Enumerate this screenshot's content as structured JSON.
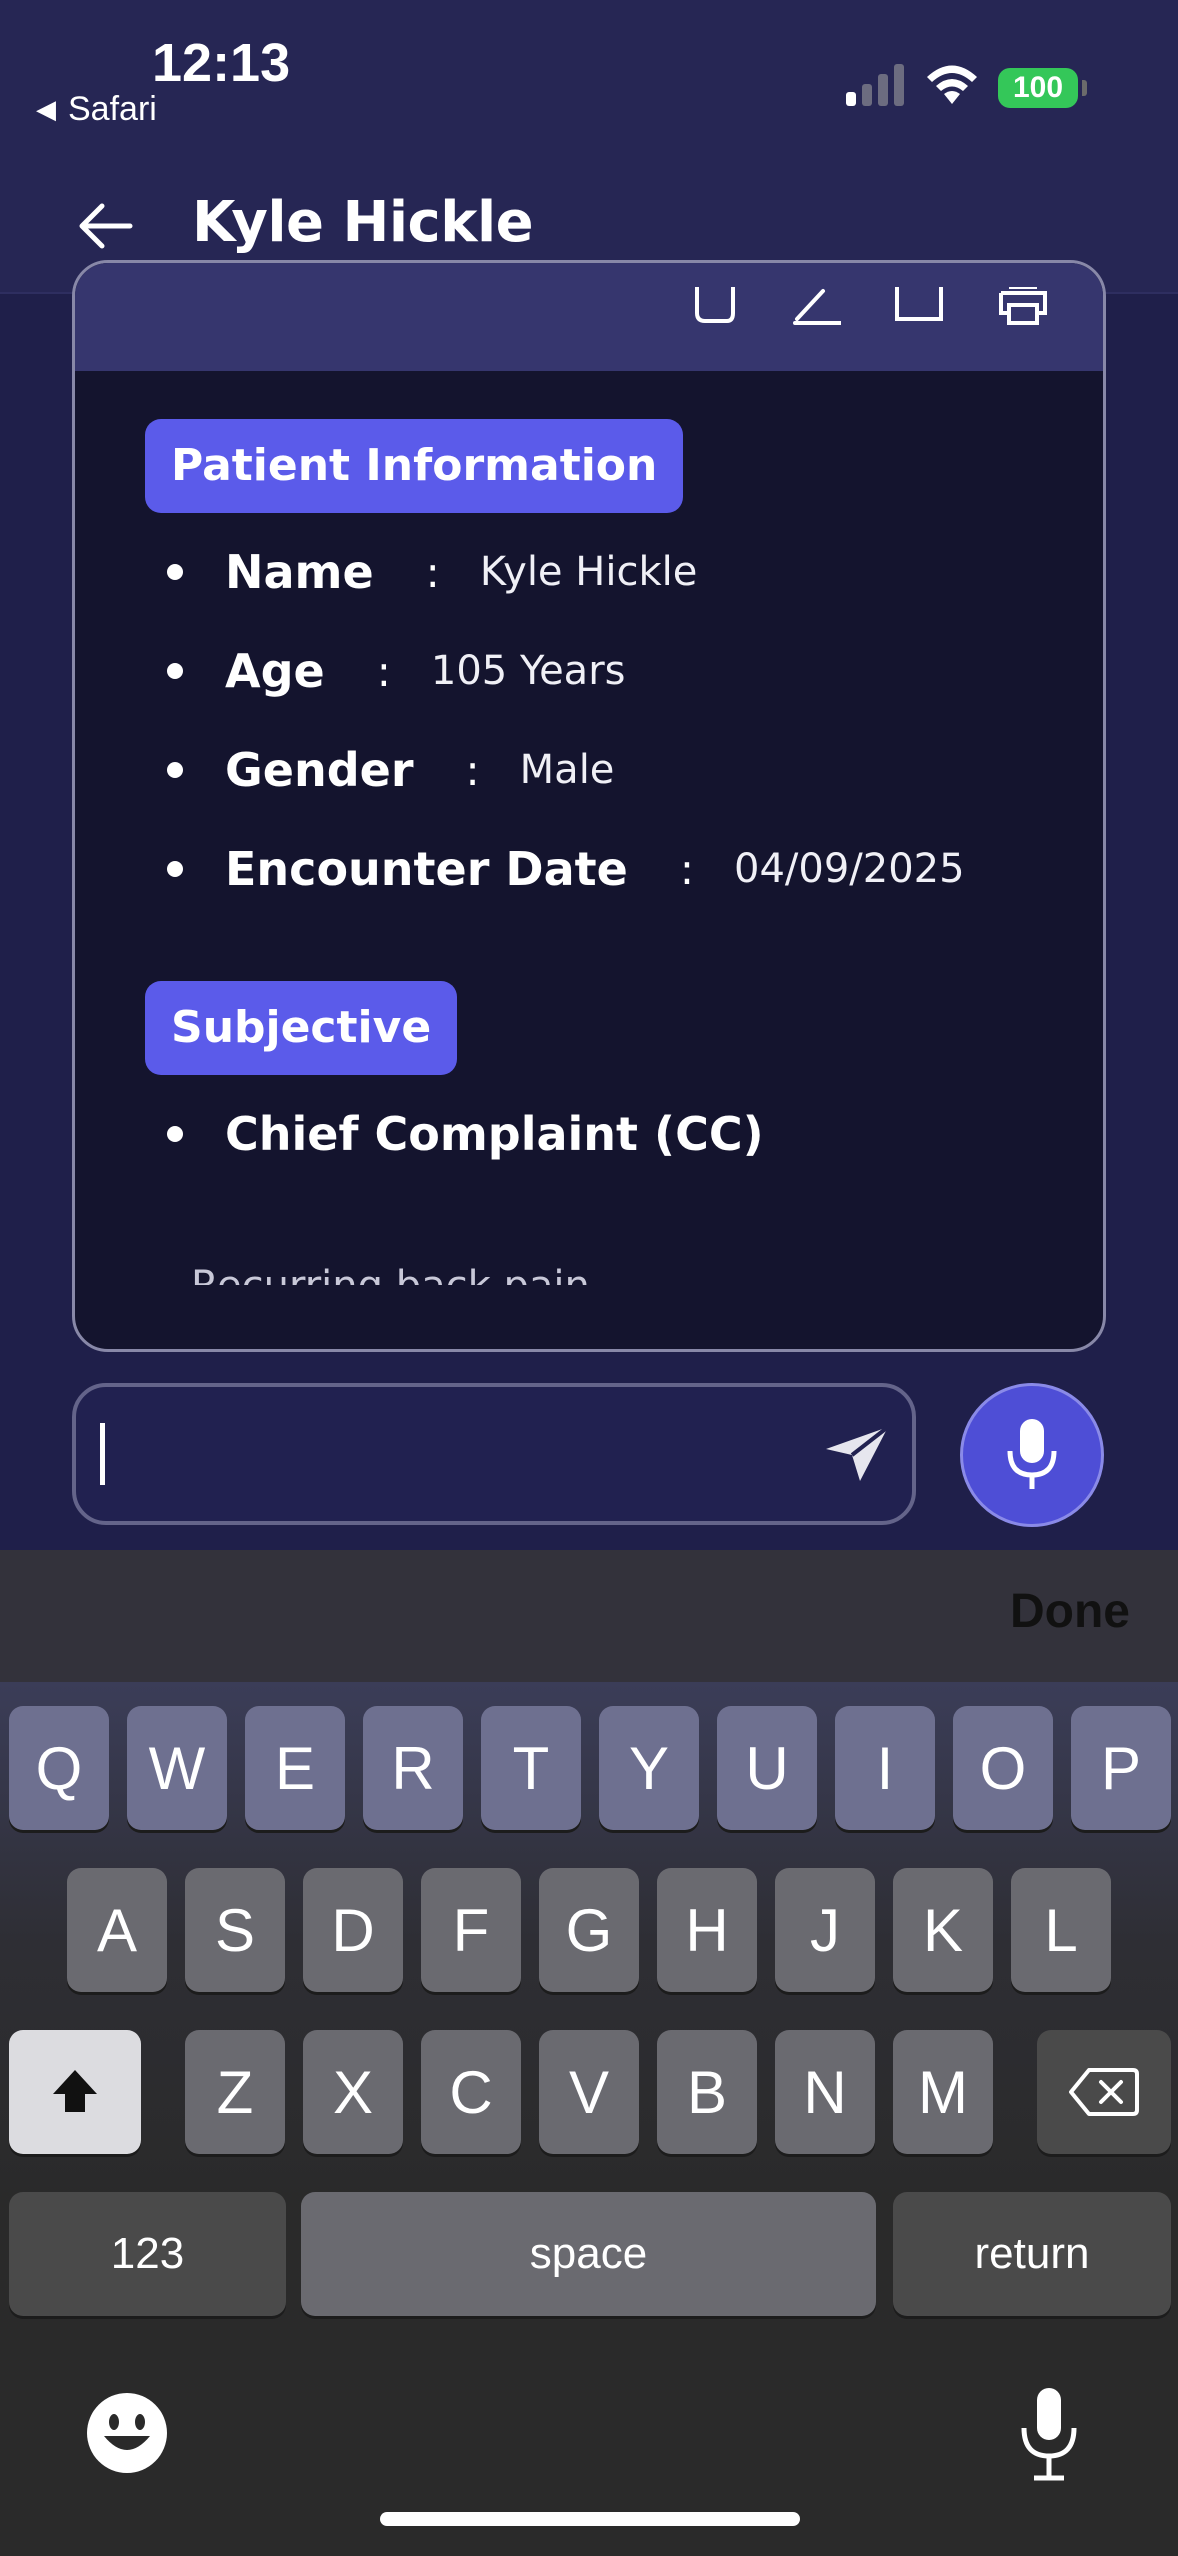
{
  "status_bar": {
    "time": "12:13",
    "back_app": "Safari",
    "battery": "100",
    "icons": [
      "signal-icon",
      "wifi-icon",
      "battery-icon"
    ]
  },
  "header": {
    "title": "Kyle Hickle",
    "back_icon": "arrow-left-icon"
  },
  "document": {
    "toolbar_icons": [
      "copy-icon",
      "edit-icon",
      "window-icon",
      "print-icon"
    ],
    "sections": [
      {
        "title": "Patient Information",
        "items": [
          {
            "label": "Name",
            "value": "Kyle Hickle"
          },
          {
            "label": "Age",
            "value": "105 Years"
          },
          {
            "label": "Gender",
            "value": "Male"
          },
          {
            "label": "Encounter Date",
            "value": "04/09/2025"
          }
        ]
      },
      {
        "title": "Subjective",
        "items": [
          {
            "label": "Chief Complaint (CC)"
          }
        ],
        "partial_text": "Recurring back pain"
      }
    ],
    "separator": ":"
  },
  "composer": {
    "input_value": "",
    "send_icon": "send-icon",
    "mic_icon": "microphone-icon"
  },
  "keyboard": {
    "done_label": "Done",
    "row1": [
      "Q",
      "W",
      "E",
      "R",
      "T",
      "Y",
      "U",
      "I",
      "O",
      "P"
    ],
    "row2": [
      "A",
      "S",
      "D",
      "F",
      "G",
      "H",
      "J",
      "K",
      "L"
    ],
    "row3": [
      "Z",
      "X",
      "C",
      "V",
      "B",
      "N",
      "M"
    ],
    "numbers_label": "123",
    "space_label": "space",
    "return_label": "return",
    "icons": [
      "shift-icon",
      "delete-icon",
      "emoji-icon",
      "dictation-icon"
    ]
  },
  "colors": {
    "background": "#1f1f4a",
    "accent": "#5b5bea",
    "card": "#14142e",
    "battery": "#34c759"
  }
}
